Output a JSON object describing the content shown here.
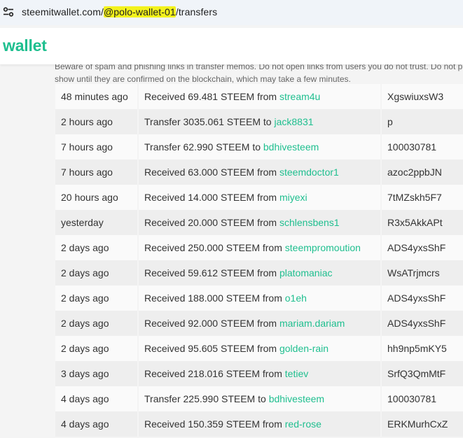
{
  "browser": {
    "url_prefix": "steemitwallet.com/",
    "url_highlight": "@polo-wallet-01",
    "url_suffix": "/transfers",
    "site_info_icon": "tune-icon",
    "highlight_color": "#f3f21b"
  },
  "header": {
    "brand": "wallet",
    "brand_color": "#1fbf8f"
  },
  "notice": {
    "line1": "Beware of spam and phishing links in transfer memos. Do not open links from users you do not trust. Do not provide",
    "line2": "show until they are confirmed on the blockchain, which may take a few minutes."
  },
  "transfers": [
    {
      "time": "48 minutes ago",
      "action": "Received 69.481 STEEM from ",
      "account": "stream4u",
      "memo": "XgswiuxsW3"
    },
    {
      "time": "2 hours ago",
      "action": "Transfer 3035.061 STEEM to ",
      "account": "jack8831",
      "memo": "p"
    },
    {
      "time": "7 hours ago",
      "action": "Transfer 62.990 STEEM to ",
      "account": "bdhivesteem",
      "memo": "100030781"
    },
    {
      "time": "7 hours ago",
      "action": "Received 63.000 STEEM from ",
      "account": "steemdoctor1",
      "memo": "azoc2ppbJN"
    },
    {
      "time": "20 hours ago",
      "action": "Received 14.000 STEEM from ",
      "account": "miyexi",
      "memo": "7tMZskh5F7"
    },
    {
      "time": "yesterday",
      "action": "Received 20.000 STEEM from ",
      "account": "schlensbens1",
      "memo": "R3x5AkkAPt"
    },
    {
      "time": "2 days ago",
      "action": "Received 250.000 STEEM from ",
      "account": "steempromoution",
      "memo": "ADS4yxsShF"
    },
    {
      "time": "2 days ago",
      "action": "Received 59.612 STEEM from ",
      "account": "platomaniac",
      "memo": "WsATrjmcrs"
    },
    {
      "time": "2 days ago",
      "action": "Received 188.000 STEEM from ",
      "account": "o1eh",
      "memo": "ADS4yxsShF"
    },
    {
      "time": "2 days ago",
      "action": "Received 92.000 STEEM from ",
      "account": "mariam.dariam",
      "memo": "ADS4yxsShF"
    },
    {
      "time": "2 days ago",
      "action": "Received 95.605 STEEM from ",
      "account": "golden-rain",
      "memo": "hh9np5mKY5"
    },
    {
      "time": "3 days ago",
      "action": "Received 218.016 STEEM from ",
      "account": "tetiev",
      "memo": "SrfQ3QmMtF"
    },
    {
      "time": "4 days ago",
      "action": "Transfer 225.990 STEEM to ",
      "account": "bdhivesteem",
      "memo": "100030781"
    },
    {
      "time": "4 days ago",
      "action": "Received 150.359 STEEM from ",
      "account": "red-rose",
      "memo": "ERKMurhCxZ"
    }
  ]
}
